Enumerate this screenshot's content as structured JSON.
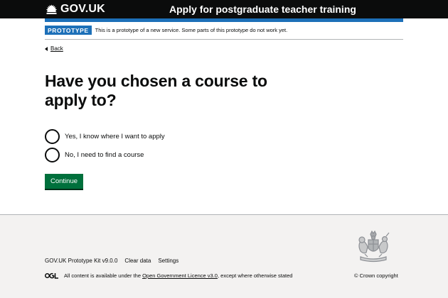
{
  "header": {
    "logo_text": "GOV.UK",
    "service_name": "Apply for postgraduate teacher training"
  },
  "phase_banner": {
    "tag": "PROTOTYPE",
    "text": "This is a prototype of a new service. Some parts of this prototype do not work yet."
  },
  "back_link": "Back",
  "question": {
    "heading": "Have you chosen a course to apply to?",
    "options": [
      {
        "label": "Yes, I know where I want to apply",
        "selected": false
      },
      {
        "label": "No, I need to find a course",
        "selected": false
      }
    ]
  },
  "continue_label": "Continue",
  "footer": {
    "links": [
      "GOV.UK Prototype Kit v9.0.0",
      "Clear data",
      "Settings"
    ],
    "licence_prefix": "All content is available under the ",
    "licence_link": "Open Government Licence v3.0",
    "licence_suffix": ", except where otherwise stated",
    "copyright": "© Crown copyright"
  },
  "colors": {
    "header_bg": "#0b0c0c",
    "brand_blue": "#1d70b8",
    "button_green": "#00703c",
    "footer_bg": "#f3f2f1"
  }
}
